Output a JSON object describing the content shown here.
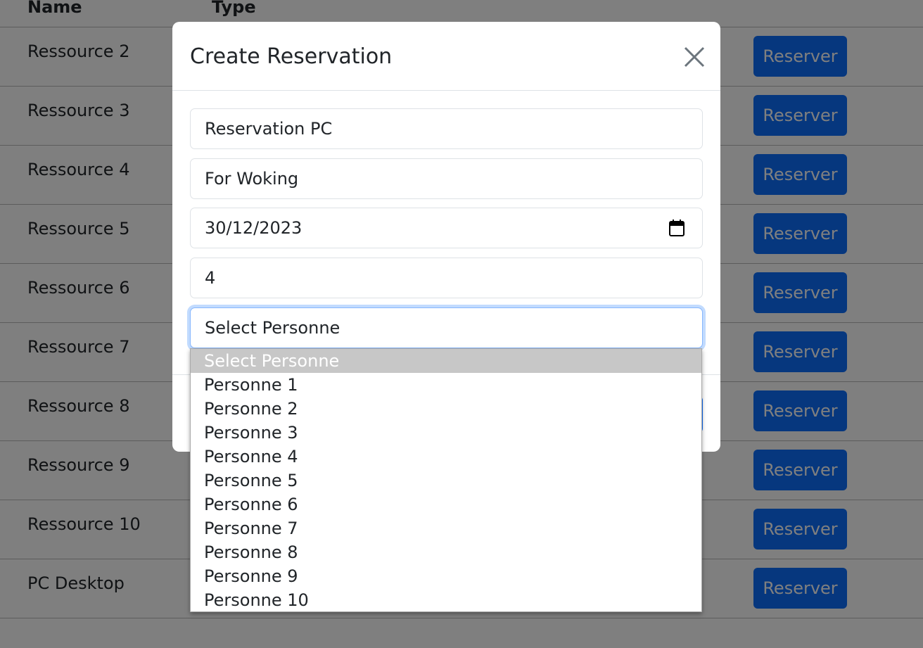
{
  "table": {
    "headers": {
      "name": "Name",
      "type": "Type"
    },
    "rows": [
      {
        "name": "Ressource 2",
        "action": "Reserver"
      },
      {
        "name": "Ressource 3",
        "action": "Reserver"
      },
      {
        "name": "Ressource 4",
        "action": "Reserver"
      },
      {
        "name": "Ressource 5",
        "action": "Reserver"
      },
      {
        "name": "Ressource 6",
        "action": "Reserver"
      },
      {
        "name": "Ressource 7",
        "action": "Reserver"
      },
      {
        "name": "Ressource 8",
        "action": "Reserver"
      },
      {
        "name": "Ressource 9",
        "action": "Reserver"
      },
      {
        "name": "Ressource 10",
        "action": "Reserver"
      },
      {
        "name": "PC Desktop",
        "action": "Reserver"
      }
    ]
  },
  "modal": {
    "title": "Create Reservation",
    "fields": {
      "title_value": "Reservation PC",
      "description_value": "For Woking",
      "date_value": "30/12/2023",
      "number_value": "4",
      "personne_selected": "Select Personne"
    },
    "personne_options": [
      "Select Personne",
      "Personne 1",
      "Personne 2",
      "Personne 3",
      "Personne 4",
      "Personne 5",
      "Personne 6",
      "Personne 7",
      "Personne 8",
      "Personne 9",
      "Personne 10"
    ]
  },
  "colors": {
    "primary": "#0d6efd",
    "option_highlight": "#c7c7c7",
    "focus_border": "#86b7fe"
  },
  "icons": {
    "close": "close-icon",
    "calendar": "calendar-icon"
  }
}
